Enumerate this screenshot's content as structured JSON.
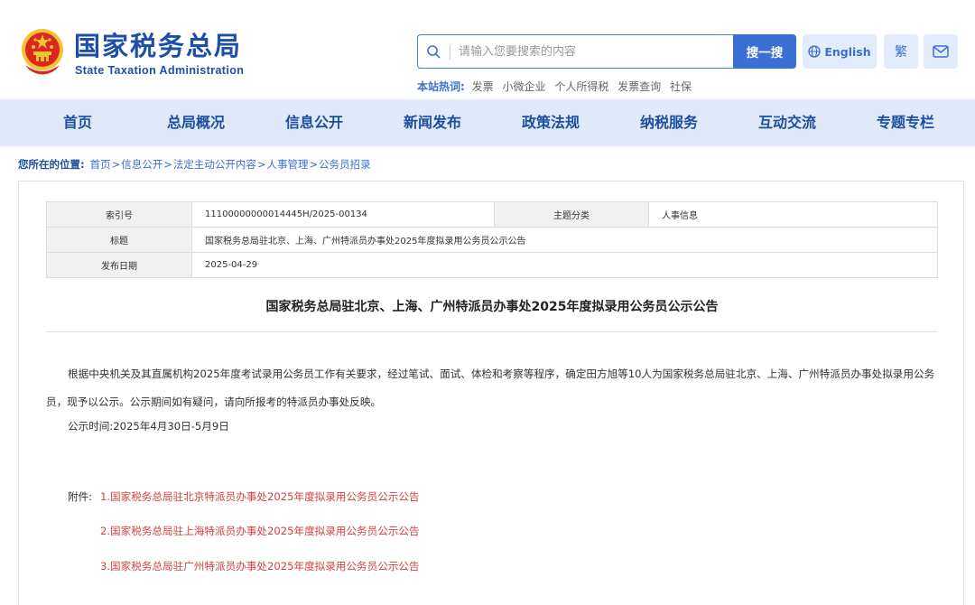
{
  "header": {
    "title": "国家税务总局",
    "subtitle": "State Taxation Administration",
    "search": {
      "placeholder": "请输入您要搜索的内容",
      "button": "搜一搜"
    },
    "english_label": "English",
    "traditional_label": "繁",
    "hot_label": "本站热词:",
    "hot_words": [
      "发票",
      "小微企业",
      "个人所得税",
      "发票查询",
      "社保"
    ]
  },
  "nav": {
    "items": [
      "首页",
      "总局概况",
      "信息公开",
      "新闻发布",
      "政策法规",
      "纳税服务",
      "互动交流",
      "专题专栏"
    ]
  },
  "breadcrumb": {
    "label": "您所在的位置:",
    "items": [
      "首页",
      "信息公开",
      "法定主动公开内容",
      "人事管理",
      "公务员招录"
    ],
    "separator": ">"
  },
  "meta": {
    "index_label": "索引号",
    "index_value": "11100000000014445H/2025-00134",
    "category_label": "主题分类",
    "category_value": "人事信息",
    "title_label": "标题",
    "title_value": "国家税务总局驻北京、上海、广州特派员办事处2025年度拟录用公务员公示公告",
    "date_label": "发布日期",
    "date_value": "2025-04-29"
  },
  "article": {
    "title": "国家税务总局驻北京、上海、广州特派员办事处2025年度拟录用公务员公示公告",
    "body": "根据中央机关及其直属机构2025年度考试录用公务员工作有关要求，经过笔试、面试、体检和考察等程序，确定田方旭等10人为国家税务总局驻北京、上海、广州特派员办事处拟录用公务员，现予以公示。公示期间如有疑问，请向所报考的特派员办事处反映。",
    "period": "公示时间:2025年4月30日-5月9日",
    "attachments_label": "附件:",
    "attachments": [
      "1.国家税务总局驻北京特派员办事处2025年度拟录用公务员公示公告",
      "2.国家税务总局驻上海特派员办事处2025年度拟录用公务员公示公告",
      "3.国家税务总局驻广州特派员办事处2025年度拟录用公务员公示公告"
    ]
  },
  "colors": {
    "brand_blue": "#1d4fa8",
    "button_blue": "#3b6fd4",
    "nav_bg": "#dfe9f8",
    "link_red": "#d2433a",
    "emblem_red": "#d8281f",
    "emblem_gold": "#f4c430"
  },
  "icons": [
    "national-emblem",
    "search-icon",
    "globe-icon",
    "mail-icon"
  ]
}
